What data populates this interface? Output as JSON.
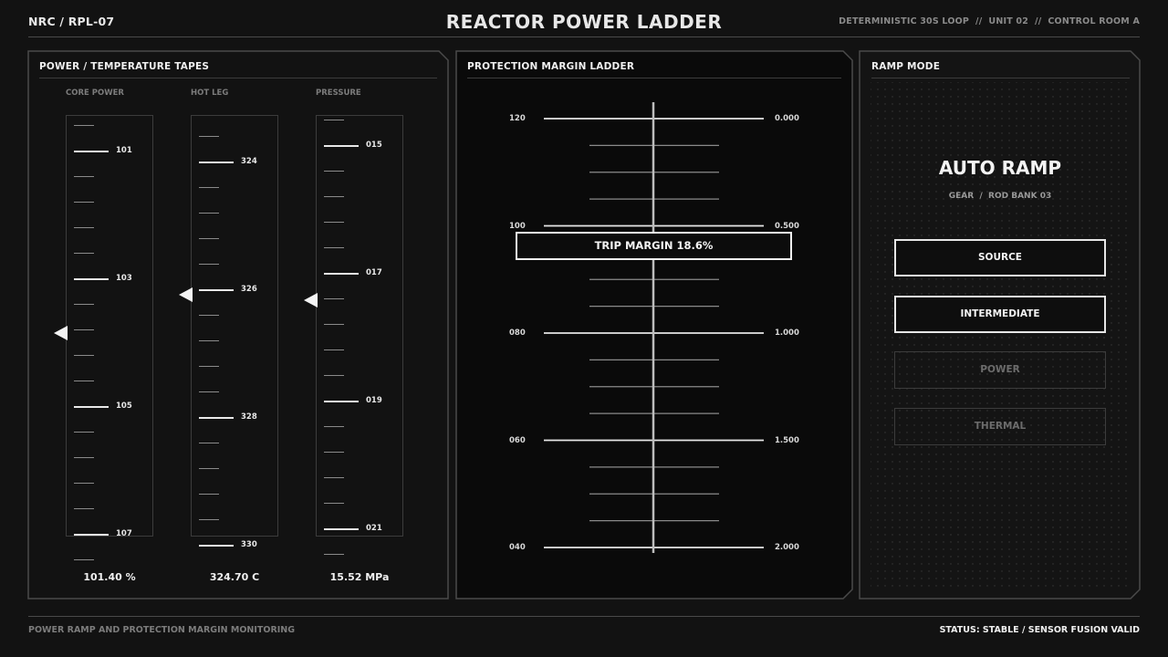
{
  "header": {
    "breadcrumb": "NRC / RPL-07",
    "title": "REACTOR POWER LADDER",
    "meta": "DETERMINISTIC 30S LOOP  //  UNIT 02  //  CONTROL ROOM A"
  },
  "tapes_panel": {
    "title": "POWER / TEMPERATURE TAPES",
    "tapes": [
      {
        "label": "CORE POWER",
        "ticks": [
          "101",
          "103",
          "105",
          "107"
        ],
        "readout": "101.40 %",
        "pointer_value": 104.14,
        "range": [
          100.6,
          107.4
        ]
      },
      {
        "label": "HOT LEG",
        "ticks": [
          "324",
          "326",
          "328",
          "330"
        ],
        "readout": "324.70 C",
        "pointer_value": 326.4,
        "range": [
          323.4,
          330.4
        ]
      },
      {
        "label": "PRESSURE",
        "ticks": [
          "015",
          "017",
          "019",
          "021"
        ],
        "readout": "15.52 MPa",
        "pointer_value": 17.7,
        "range": [
          14.7,
          21.5
        ]
      }
    ]
  },
  "ladder_panel": {
    "title": "PROTECTION MARGIN LADDER",
    "left_labels": [
      "120",
      "100",
      "080",
      "060",
      "040"
    ],
    "right_labels": [
      "0.000",
      "0.500",
      "1.000",
      "1.500",
      "2.000"
    ],
    "trip_margin": "TRIP MARGIN 18.6%"
  },
  "ramp_panel": {
    "title": "RAMP MODE",
    "mode": "AUTO RAMP",
    "gear_label": "GEAR",
    "gear_value": "ROD BANK 03",
    "buttons": [
      {
        "label": "SOURCE",
        "state": "active"
      },
      {
        "label": "INTERMEDIATE",
        "state": "active"
      },
      {
        "label": "POWER",
        "state": "dim"
      },
      {
        "label": "THERMAL",
        "state": "dim"
      }
    ]
  },
  "footer": {
    "left": "POWER RAMP AND PROTECTION MARGIN MONITORING",
    "right": "STATUS: STABLE / SENSOR FUSION VALID"
  },
  "colors": {
    "background": "#121212",
    "panel": "#0c0c0c",
    "accent": "#f0f0f0",
    "dim": "#6c6c6c"
  }
}
